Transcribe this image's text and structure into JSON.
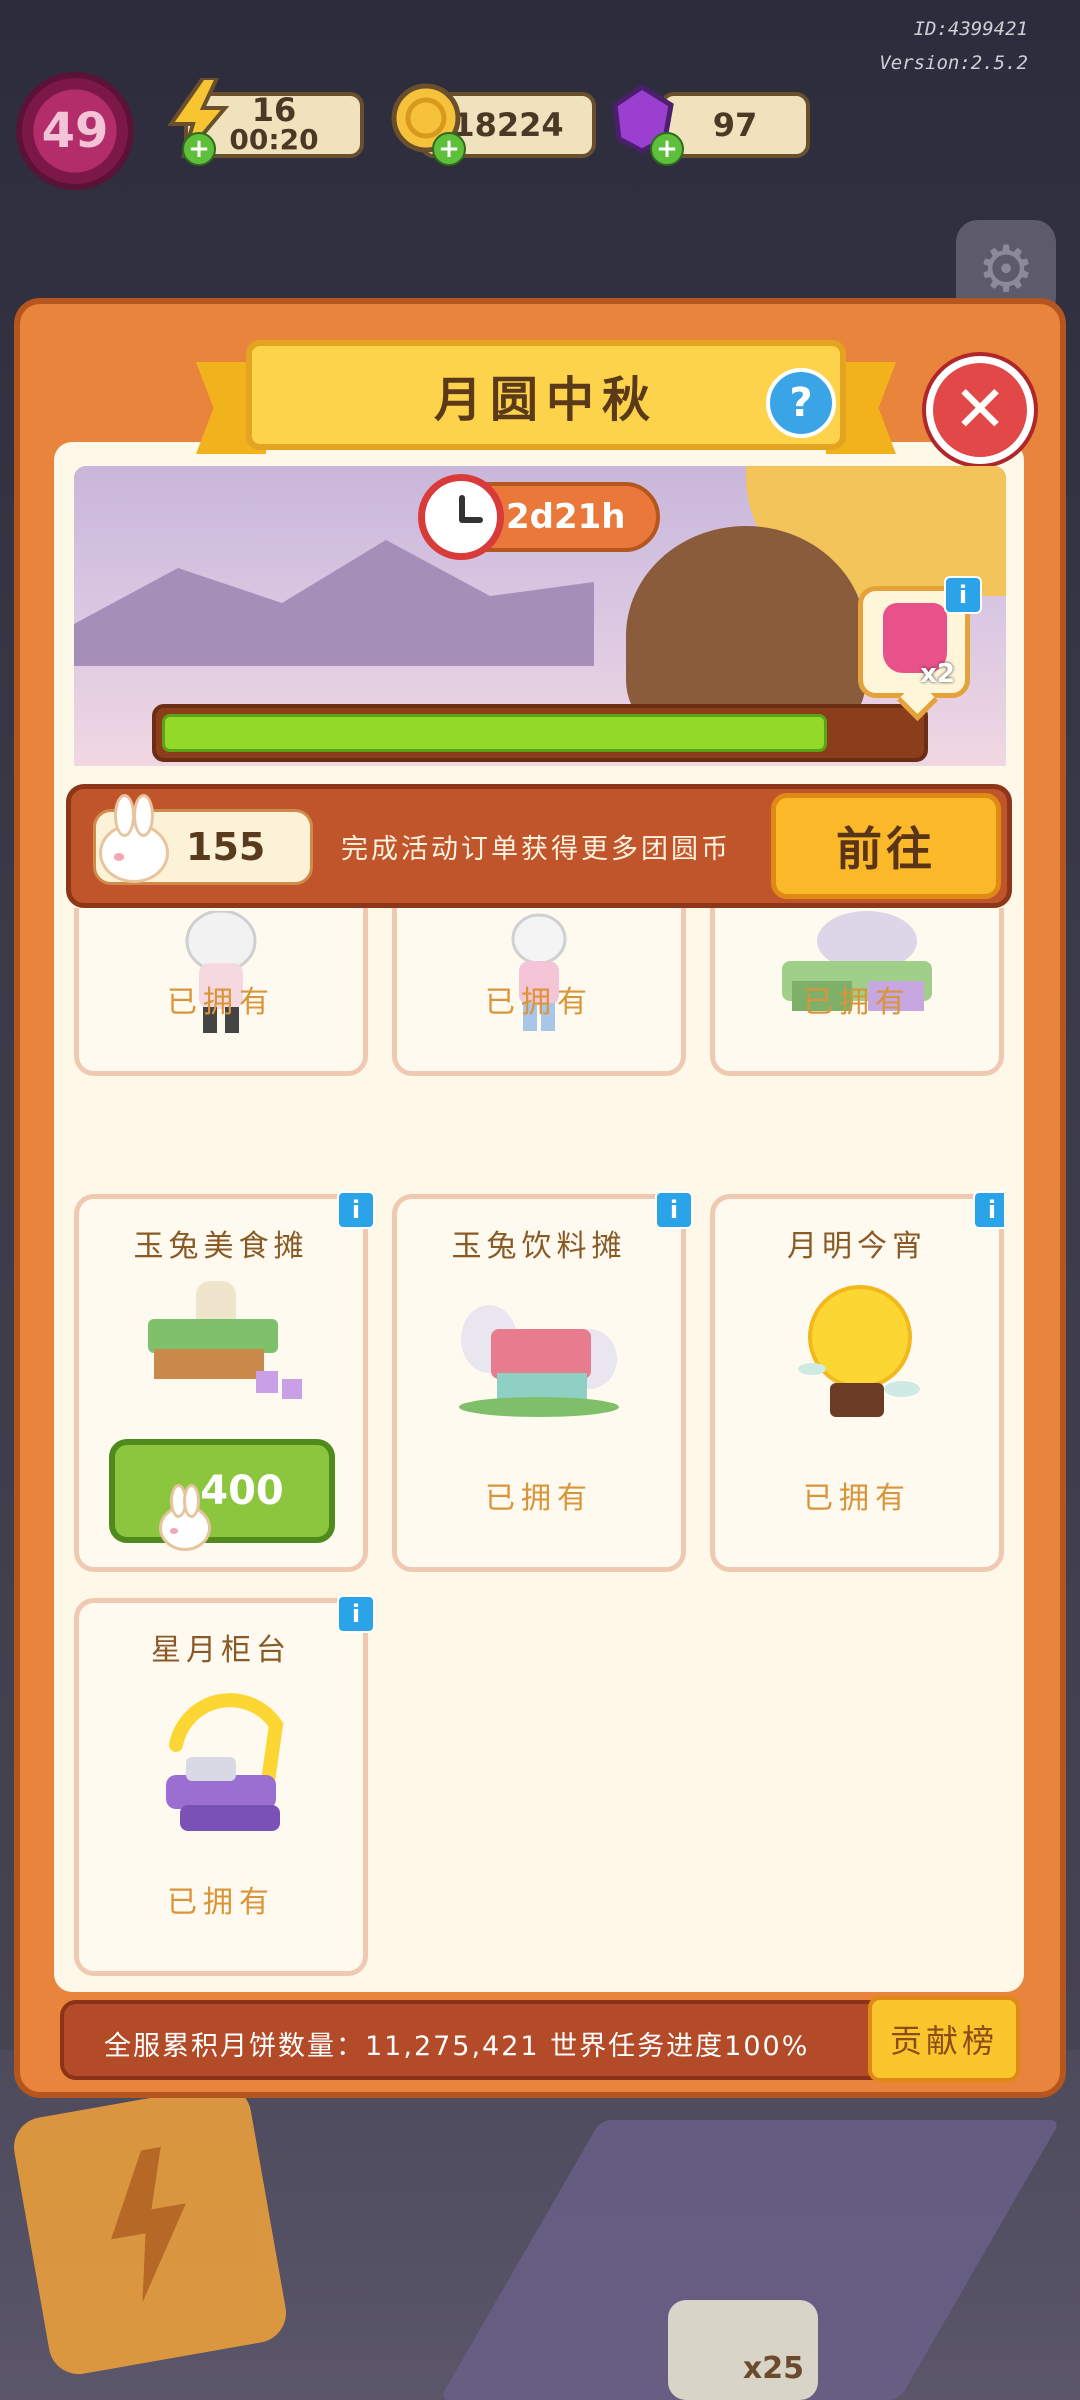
{
  "hud": {
    "id_text": "ID:4399421",
    "version_text": "Version:2.5.2",
    "level": "49",
    "energy": "16",
    "energy_timer": "00:20",
    "coins": "18224",
    "gems": "97"
  },
  "modal": {
    "title": "月圆中秋",
    "help_label": "?",
    "close_label": "✕",
    "timer": "2d21h",
    "progress": 0.88,
    "reward_multiplier": "x2",
    "currency_amount": "155",
    "currency_desc": "完成活动订单获得更多团圆币",
    "go_label": "前往",
    "info_label": "i"
  },
  "grid": {
    "row1": [
      {
        "status": "已拥有"
      },
      {
        "status": "已拥有"
      },
      {
        "status": "已拥有"
      }
    ],
    "row2": [
      {
        "title": "玉兔美食摊",
        "price": "400"
      },
      {
        "title": "玉兔饮料摊",
        "status": "已拥有"
      },
      {
        "title": "月明今宵",
        "status": "已拥有"
      }
    ],
    "row3": [
      {
        "title": "星月柜台",
        "status": "已拥有"
      }
    ]
  },
  "footer": {
    "world_text": "全服累积月饼数量：11,275,421   世界任务进度100%",
    "rank_label": "贡献榜"
  },
  "background": {
    "bottom_badge": "x25"
  },
  "colors": {
    "modal_orange": "#e8843c",
    "banner_yellow": "#fcd34a",
    "progress_green": "#93d92a",
    "close_red": "#e34848",
    "info_blue": "#2ba3e8"
  }
}
